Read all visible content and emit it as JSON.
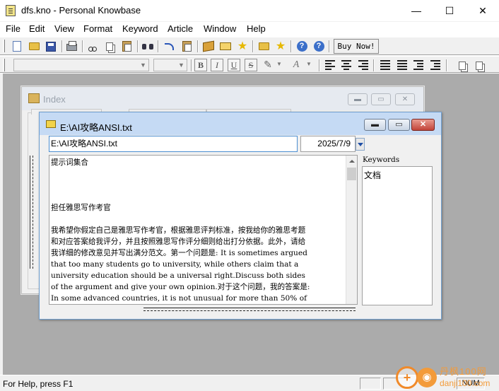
{
  "window": {
    "title": "dfs.kno - Personal Knowbase",
    "minimize": "—",
    "maximize": "☐",
    "close": "✕"
  },
  "menu": [
    "File",
    "Edit",
    "View",
    "Format",
    "Keyword",
    "Article",
    "Window",
    "Help"
  ],
  "toolbar": {
    "buy_now": "Buy Now!",
    "icons": [
      "new-document",
      "open-folder",
      "save-disk",
      "print",
      "cut",
      "copy",
      "paste",
      "find",
      "undo",
      "redo-clipboard",
      "articles-book",
      "keywords-book",
      "favorites-star",
      "folder",
      "bookmark-star",
      "help",
      "context-help"
    ]
  },
  "format_toolbar": {
    "font_name": "",
    "font_size": "",
    "bold": "B",
    "italic": "I",
    "underline": "U",
    "strikethrough": "S",
    "highlighter": "✎",
    "font_color": "A"
  },
  "index_window": {
    "title": "Index"
  },
  "doc_window": {
    "title": "E:\\AI攻略ANSI.txt",
    "path_value": "E:\\AI攻略ANSI.txt",
    "date_value": "2025/7/9",
    "text_lines": [
      "提示词集合",
      "",
      "",
      "",
      "担任雅思写作考官",
      "",
      "我希望你假定自己是雅思写作考官，根据雅思评判标准，按我给你的雅思考题",
      "和对应答案给我评分，并且按照雅思写作评分细则给出打分依据。此外，请给",
      "我详细的修改意见并写出满分范文。第一个问题是: It is sometimes argued",
      "that too many students go to university, while others claim that a",
      "university education should be a universal right.Discuss both sides",
      "of the argument and give your own opinion.对于这个问题，我的答案是:",
      "In some advanced countries, it is not unusual for more than 50% of"
    ],
    "keywords_label": "Keywords",
    "keywords": [
      "文档"
    ]
  },
  "statusbar": {
    "text": "For Help, press F1",
    "num": "NUM"
  },
  "watermark": {
    "cn": "丹枫100网",
    "en": "danji100.com",
    "symbol": "+"
  }
}
